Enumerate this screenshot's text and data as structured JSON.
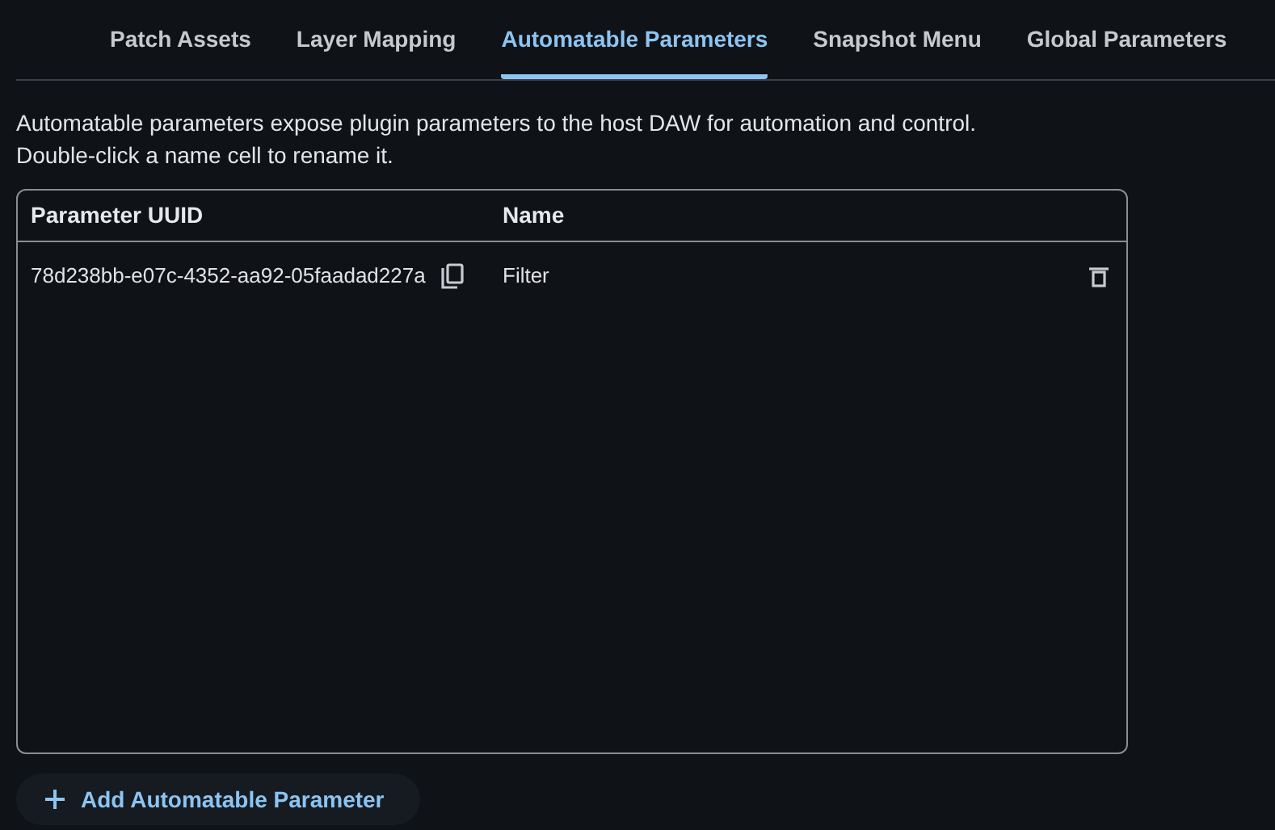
{
  "tabs": [
    {
      "label": "Patch Assets",
      "selected": false
    },
    {
      "label": "Layer Mapping",
      "selected": false
    },
    {
      "label": "Automatable Parameters",
      "selected": true
    },
    {
      "label": "Snapshot Menu",
      "selected": false
    },
    {
      "label": "Global Parameters",
      "selected": false
    }
  ],
  "description": [
    "Automatable parameters expose plugin parameters to the host DAW for automation and control.",
    "Double-click a name cell to rename it."
  ],
  "table": {
    "columns": [
      "Parameter UUID",
      "Name"
    ],
    "rows": [
      {
        "uuid": "78d238bb-e07c-4352-aa92-05faadad227a",
        "name": "Filter"
      }
    ]
  },
  "add_button": {
    "label": "Add Automatable Parameter"
  }
}
